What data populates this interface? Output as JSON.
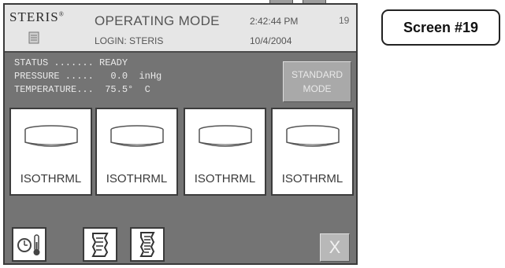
{
  "header": {
    "brand": "STERIS",
    "mode_title": "OPERATING MODE",
    "login": "LOGIN: STERIS",
    "time": "2:42:44 PM",
    "date": "10/4/2004",
    "screen_number": "19"
  },
  "status": {
    "line1": "STATUS ....... READY",
    "line2": "PRESSURE .....   0.0  inHg",
    "line3": "TEMPERATURE...  75.5°  C"
  },
  "buttons": {
    "standard_mode": "STANDARD\nMODE",
    "close": "X"
  },
  "cycles": [
    {
      "label": "ISOTHRML"
    },
    {
      "label": "ISOTHRML"
    },
    {
      "label": "ISOTHRML"
    },
    {
      "label": "ISOTHRML"
    }
  ],
  "toolbar": {
    "icons": [
      "clock-thermometer-icon",
      "printout-icon",
      "log-report-icon"
    ]
  },
  "callout": {
    "text": "Screen #19"
  }
}
